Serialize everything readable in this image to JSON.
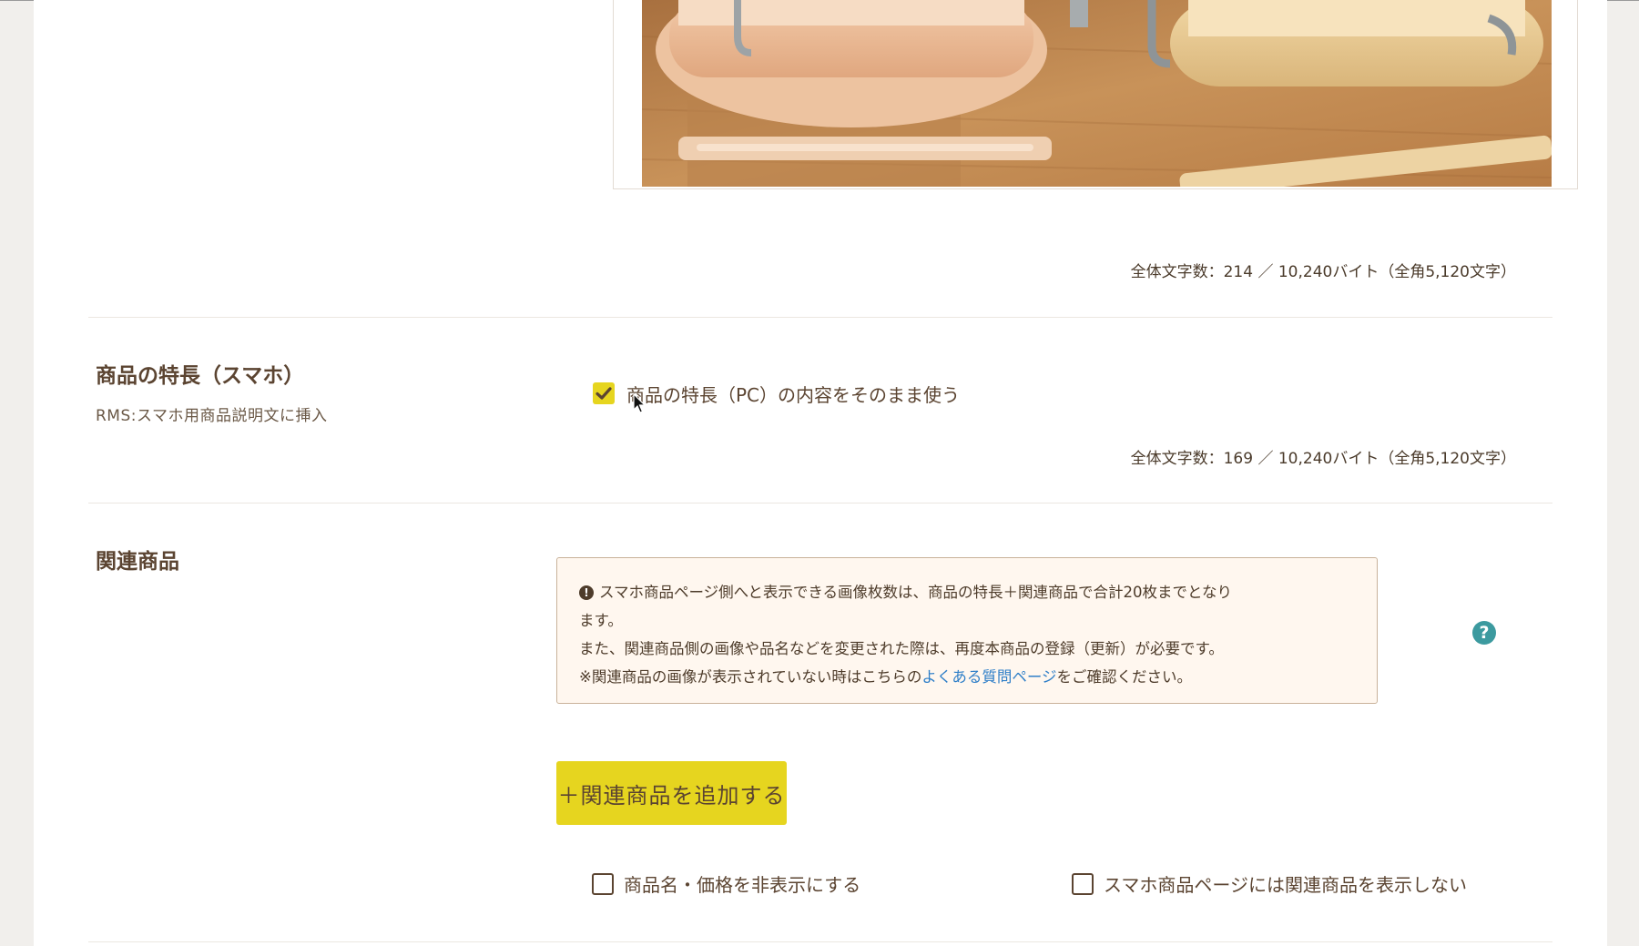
{
  "top_count": {
    "label": "全体文字数：214 ／ 10,240バイト（全角5,120文字）"
  },
  "feature_sp": {
    "title": "商品の特長（スマホ）",
    "subtitle": "RMS:スマホ用商品説明文に挿入",
    "use_pc_checkbox": {
      "label": "商品の特長（PC）の内容をそのまま使う",
      "checked": true
    },
    "count_label": "全体文字数：169 ／ 10,240バイト（全角5,120文字）"
  },
  "related": {
    "title": "関連商品",
    "notice": {
      "line1": "スマホ商品ページ側へと表示できる画像枚数は、商品の特長＋関連商品で合計20枚までとなり",
      "line2": "ます。",
      "line3": "また、関連商品側の画像や品名などを変更された際は、再度本商品の登録（更新）が必要です。",
      "line4_prefix": "※関連商品の画像が表示されていない時はこちらの",
      "line4_link": "よくある質問ページ",
      "line4_suffix": "をご確認ください。"
    },
    "add_button_label": "＋関連商品を追加する",
    "hide_name_price": {
      "label": "商品名・価格を非表示にする",
      "checked": false
    },
    "hide_on_sp": {
      "label": "スマホ商品ページには関連商品を表示しない",
      "checked": false
    }
  },
  "colors": {
    "accent_yellow": "#e6d51f",
    "brown_text": "#5b4431",
    "link_blue": "#2f7fc8",
    "help_teal": "#3c9a9f",
    "notice_bg": "#fff7ef"
  },
  "icons": [
    "check-icon",
    "warning-icon",
    "help-icon",
    "cursor-icon"
  ]
}
